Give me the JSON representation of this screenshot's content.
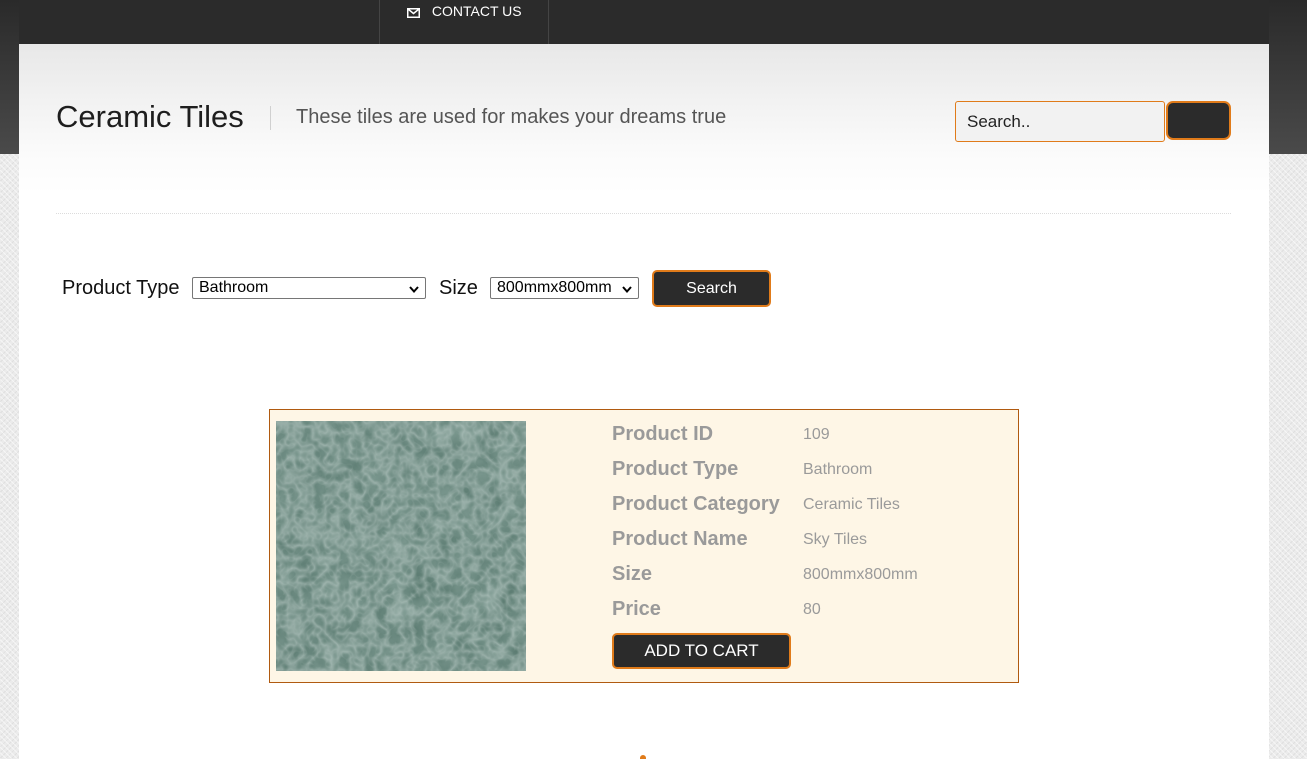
{
  "nav": {
    "items": [
      {
        "label": "CONTACT US",
        "icon": "envelope-icon"
      }
    ]
  },
  "header": {
    "title": "Ceramic Tiles",
    "tagline": "These tiles are used for makes your dreams true",
    "search_placeholder": "Search..",
    "search_button_label": ""
  },
  "filters": {
    "product_type_label": "Product Type",
    "product_type_selected": "Bathroom",
    "size_label": "Size",
    "size_selected": "800mmx800mm",
    "search_button": "Search"
  },
  "product": {
    "image_icon": "green-marble-tile-image",
    "specs": [
      {
        "label": "Product ID",
        "value": "109"
      },
      {
        "label": "Product Type",
        "value": "Bathroom"
      },
      {
        "label": "Product Category",
        "value": "Ceramic Tiles"
      },
      {
        "label": "Product Name",
        "value": "Sky Tiles"
      },
      {
        "label": "Size",
        "value": "800mmx800mm"
      },
      {
        "label": "Price",
        "value": "80"
      }
    ],
    "add_to_cart": "ADD TO CART"
  },
  "colors": {
    "accent": "#e07b1a",
    "dark": "#2b2b2b",
    "card_bg": "#fef6e6",
    "tile_green": "#5b7b71"
  }
}
